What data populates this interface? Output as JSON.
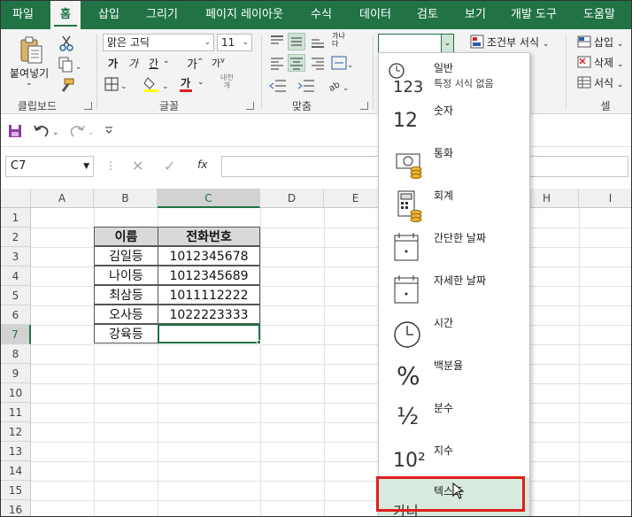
{
  "tabs": [
    "파일",
    "홈",
    "삽입",
    "그리기",
    "페이지 레이아웃",
    "수식",
    "데이터",
    "검토",
    "보기",
    "개발 도구",
    "도움말"
  ],
  "active_tab": "홈",
  "ribbon": {
    "clipboard": {
      "paste_label": "붙여넣기",
      "group_label": "클립보드"
    },
    "font": {
      "font_name": "맑은 고딕",
      "font_size": "11",
      "group_label": "글꼴",
      "bold": "가",
      "italic": "가",
      "underline": "간",
      "grow": "가",
      "shrink": "가",
      "color_glyph": "가",
      "phonetic_top": "내천",
      "phonetic_bottom": "개"
    },
    "align": {
      "group_label": "맞춤",
      "wrap_top": "가나",
      "wrap_bottom": "다"
    },
    "number": {
      "format_value": ""
    },
    "styles": {
      "conditional": "조건부 서식"
    },
    "cells": {
      "insert": "삽입",
      "delete": "삭제",
      "format": "서식",
      "group_label": "셀"
    }
  },
  "namebox": "C7",
  "fx_label": "fx",
  "columns": [
    "A",
    "B",
    "C",
    "D",
    "E",
    "F",
    "G",
    "H",
    "I"
  ],
  "rows": [
    "1",
    "2",
    "3",
    "4",
    "5",
    "6",
    "7",
    "8",
    "9",
    "10",
    "11",
    "12",
    "13",
    "14",
    "15",
    "16"
  ],
  "selected_cell": {
    "column": "C",
    "row": "7"
  },
  "table": {
    "headers": [
      "이름",
      "전화번호"
    ],
    "rows": [
      [
        "김일등",
        "1012345678"
      ],
      [
        "나이등",
        "1012345689"
      ],
      [
        "최삼등",
        "1011112222"
      ],
      [
        "오사등",
        "1022223333"
      ],
      [
        "강육등",
        ""
      ]
    ]
  },
  "number_formats": [
    {
      "name": "일반",
      "sub": "특정 서식 없음",
      "icon": "general-icon",
      "glyph": "123"
    },
    {
      "name": "숫자",
      "sub": "",
      "icon": "number-icon",
      "glyph": "12"
    },
    {
      "name": "통화",
      "sub": "",
      "icon": "currency-icon",
      "glyph": ""
    },
    {
      "name": "회계",
      "sub": "",
      "icon": "accounting-icon",
      "glyph": ""
    },
    {
      "name": "간단한 날짜",
      "sub": "",
      "icon": "short-date-icon",
      "glyph": ""
    },
    {
      "name": "자세한 날짜",
      "sub": "",
      "icon": "long-date-icon",
      "glyph": ""
    },
    {
      "name": "시간",
      "sub": "",
      "icon": "time-icon",
      "glyph": ""
    },
    {
      "name": "백분율",
      "sub": "",
      "icon": "percent-icon",
      "glyph": "%"
    },
    {
      "name": "분수",
      "sub": "",
      "icon": "fraction-icon",
      "glyph": "½"
    },
    {
      "name": "지수",
      "sub": "",
      "icon": "scientific-icon",
      "glyph": "10²"
    },
    {
      "name": "텍스트",
      "sub": "",
      "icon": "text-icon",
      "glyph": "가나"
    }
  ],
  "highlighted_format": "텍스트",
  "colors": {
    "brand": "#217346",
    "highlight": "#d7eadd",
    "outline": "#e01e1e"
  }
}
